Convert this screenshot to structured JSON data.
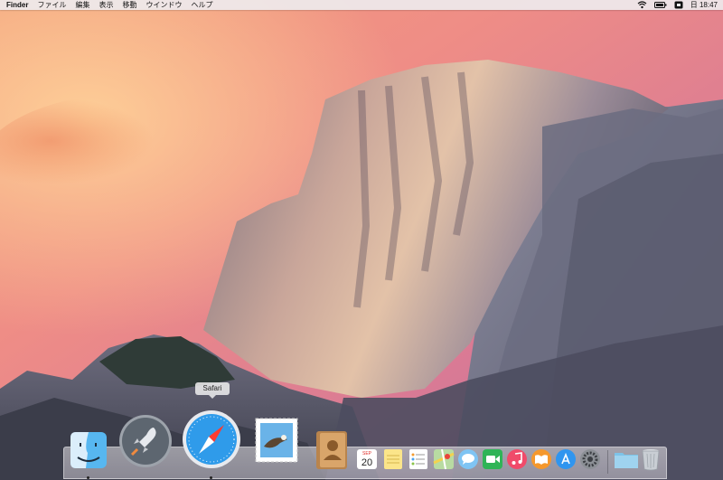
{
  "menubar": {
    "app_name": "Finder",
    "menus": [
      "ファイル",
      "編集",
      "表示",
      "移動",
      "ウインドウ",
      "ヘルプ"
    ],
    "clock": "日 18:47",
    "status_icons": [
      "wifi-icon",
      "battery-icon",
      "input-method-icon"
    ]
  },
  "dock": {
    "tooltip": "Safari",
    "calendar": {
      "month": "SEP",
      "day": "20"
    },
    "apps": [
      "finder",
      "launchpad",
      "safari",
      "mail",
      "contacts",
      "calendar",
      "notes",
      "reminders",
      "maps",
      "messages",
      "facetime",
      "itunes",
      "ibooks",
      "app-store",
      "system-preferences",
      "downloads-folder",
      "trash"
    ]
  },
  "colors": {
    "sky_top": "#e56f8a",
    "sky_mid": "#f0a090",
    "rock": "#8a8a9a",
    "dock": "#d8d4dc"
  }
}
